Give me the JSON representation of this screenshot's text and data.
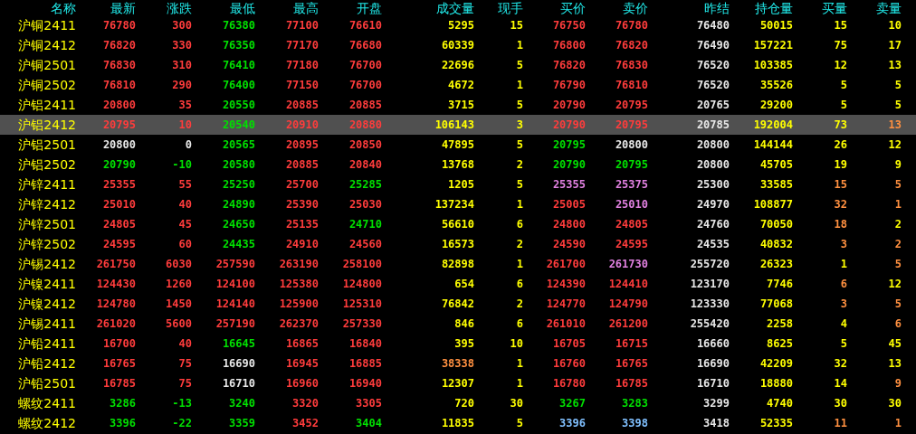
{
  "columns": [
    "名称",
    "最新",
    "涨跌",
    "最低",
    "最高",
    "开盘",
    "成交量",
    "现手",
    "买价",
    "卖价",
    "昨结",
    "持仓量",
    "买量",
    "卖量"
  ],
  "rows": [
    {
      "selected": false,
      "cells": [
        {
          "text": "沪铜2411",
          "color": "#ffff00"
        },
        {
          "text": "76780",
          "color": "#ff3c3c"
        },
        {
          "text": "300",
          "color": "#ff3c3c"
        },
        {
          "text": "76380",
          "color": "#00e000"
        },
        {
          "text": "77100",
          "color": "#ff3c3c"
        },
        {
          "text": "76610",
          "color": "#ff3c3c"
        },
        {
          "text": "5295",
          "color": "#ffff00"
        },
        {
          "text": "15",
          "color": "#ffff00"
        },
        {
          "text": "76750",
          "color": "#ff3c3c"
        },
        {
          "text": "76780",
          "color": "#ff3c3c"
        },
        {
          "text": "76480",
          "color": "#e8e8e8"
        },
        {
          "text": "50015",
          "color": "#ffff00"
        },
        {
          "text": "15",
          "color": "#ffff00"
        },
        {
          "text": "10",
          "color": "#ffff00"
        }
      ]
    },
    {
      "selected": false,
      "cells": [
        {
          "text": "沪铜2412",
          "color": "#ffff00"
        },
        {
          "text": "76820",
          "color": "#ff3c3c"
        },
        {
          "text": "330",
          "color": "#ff3c3c"
        },
        {
          "text": "76350",
          "color": "#00e000"
        },
        {
          "text": "77170",
          "color": "#ff3c3c"
        },
        {
          "text": "76680",
          "color": "#ff3c3c"
        },
        {
          "text": "60339",
          "color": "#ffff00"
        },
        {
          "text": "1",
          "color": "#ffff00"
        },
        {
          "text": "76800",
          "color": "#ff3c3c"
        },
        {
          "text": "76820",
          "color": "#ff3c3c"
        },
        {
          "text": "76490",
          "color": "#e8e8e8"
        },
        {
          "text": "157221",
          "color": "#ffff00"
        },
        {
          "text": "75",
          "color": "#ffff00"
        },
        {
          "text": "17",
          "color": "#ffff00"
        }
      ]
    },
    {
      "selected": false,
      "cells": [
        {
          "text": "沪铜2501",
          "color": "#ffff00"
        },
        {
          "text": "76830",
          "color": "#ff3c3c"
        },
        {
          "text": "310",
          "color": "#ff3c3c"
        },
        {
          "text": "76410",
          "color": "#00e000"
        },
        {
          "text": "77180",
          "color": "#ff3c3c"
        },
        {
          "text": "76700",
          "color": "#ff3c3c"
        },
        {
          "text": "22696",
          "color": "#ffff00"
        },
        {
          "text": "5",
          "color": "#ffff00"
        },
        {
          "text": "76820",
          "color": "#ff3c3c"
        },
        {
          "text": "76830",
          "color": "#ff3c3c"
        },
        {
          "text": "76520",
          "color": "#e8e8e8"
        },
        {
          "text": "103385",
          "color": "#ffff00"
        },
        {
          "text": "12",
          "color": "#ffff00"
        },
        {
          "text": "13",
          "color": "#ffff00"
        }
      ]
    },
    {
      "selected": false,
      "cells": [
        {
          "text": "沪铜2502",
          "color": "#ffff00"
        },
        {
          "text": "76810",
          "color": "#ff3c3c"
        },
        {
          "text": "290",
          "color": "#ff3c3c"
        },
        {
          "text": "76400",
          "color": "#00e000"
        },
        {
          "text": "77150",
          "color": "#ff3c3c"
        },
        {
          "text": "76700",
          "color": "#ff3c3c"
        },
        {
          "text": "4672",
          "color": "#ffff00"
        },
        {
          "text": "1",
          "color": "#ffff00"
        },
        {
          "text": "76790",
          "color": "#ff3c3c"
        },
        {
          "text": "76810",
          "color": "#ff3c3c"
        },
        {
          "text": "76520",
          "color": "#e8e8e8"
        },
        {
          "text": "35526",
          "color": "#ffff00"
        },
        {
          "text": "5",
          "color": "#ffff00"
        },
        {
          "text": "5",
          "color": "#ffff00"
        }
      ]
    },
    {
      "selected": false,
      "cells": [
        {
          "text": "沪铝2411",
          "color": "#ffff00"
        },
        {
          "text": "20800",
          "color": "#ff3c3c"
        },
        {
          "text": "35",
          "color": "#ff3c3c"
        },
        {
          "text": "20550",
          "color": "#00e000"
        },
        {
          "text": "20885",
          "color": "#ff3c3c"
        },
        {
          "text": "20885",
          "color": "#ff3c3c"
        },
        {
          "text": "3715",
          "color": "#ffff00"
        },
        {
          "text": "5",
          "color": "#ffff00"
        },
        {
          "text": "20790",
          "color": "#ff3c3c"
        },
        {
          "text": "20795",
          "color": "#ff3c3c"
        },
        {
          "text": "20765",
          "color": "#e8e8e8"
        },
        {
          "text": "29200",
          "color": "#ffff00"
        },
        {
          "text": "5",
          "color": "#ffff00"
        },
        {
          "text": "5",
          "color": "#ffff00"
        }
      ]
    },
    {
      "selected": true,
      "cells": [
        {
          "text": "沪铝2412",
          "color": "#ffff00"
        },
        {
          "text": "20795",
          "color": "#ff3c3c"
        },
        {
          "text": "10",
          "color": "#ff3c3c"
        },
        {
          "text": "20540",
          "color": "#00e000"
        },
        {
          "text": "20910",
          "color": "#ff3c3c"
        },
        {
          "text": "20880",
          "color": "#ff3c3c"
        },
        {
          "text": "106143",
          "color": "#ffff00"
        },
        {
          "text": "3",
          "color": "#ffff00"
        },
        {
          "text": "20790",
          "color": "#ff3c3c"
        },
        {
          "text": "20795",
          "color": "#ff3c3c"
        },
        {
          "text": "20785",
          "color": "#e8e8e8"
        },
        {
          "text": "192004",
          "color": "#ffff00"
        },
        {
          "text": "73",
          "color": "#ffff00"
        },
        {
          "text": "13",
          "color": "#ff9040"
        }
      ]
    },
    {
      "selected": false,
      "cells": [
        {
          "text": "沪铝2501",
          "color": "#ffff00"
        },
        {
          "text": "20800",
          "color": "#e8e8e8"
        },
        {
          "text": "0",
          "color": "#e8e8e8"
        },
        {
          "text": "20565",
          "color": "#00e000"
        },
        {
          "text": "20895",
          "color": "#ff3c3c"
        },
        {
          "text": "20850",
          "color": "#ff3c3c"
        },
        {
          "text": "47895",
          "color": "#ffff00"
        },
        {
          "text": "5",
          "color": "#ffff00"
        },
        {
          "text": "20795",
          "color": "#00e000"
        },
        {
          "text": "20800",
          "color": "#e8e8e8"
        },
        {
          "text": "20800",
          "color": "#e8e8e8"
        },
        {
          "text": "144144",
          "color": "#ffff00"
        },
        {
          "text": "26",
          "color": "#ffff00"
        },
        {
          "text": "12",
          "color": "#ffff00"
        }
      ]
    },
    {
      "selected": false,
      "cells": [
        {
          "text": "沪铝2502",
          "color": "#ffff00"
        },
        {
          "text": "20790",
          "color": "#00e000"
        },
        {
          "text": "-10",
          "color": "#00e000"
        },
        {
          "text": "20580",
          "color": "#00e000"
        },
        {
          "text": "20885",
          "color": "#ff3c3c"
        },
        {
          "text": "20840",
          "color": "#ff3c3c"
        },
        {
          "text": "13768",
          "color": "#ffff00"
        },
        {
          "text": "2",
          "color": "#ffff00"
        },
        {
          "text": "20790",
          "color": "#00e000"
        },
        {
          "text": "20795",
          "color": "#00e000"
        },
        {
          "text": "20800",
          "color": "#e8e8e8"
        },
        {
          "text": "45705",
          "color": "#ffff00"
        },
        {
          "text": "19",
          "color": "#ffff00"
        },
        {
          "text": "9",
          "color": "#ffff00"
        }
      ]
    },
    {
      "selected": false,
      "cells": [
        {
          "text": "沪锌2411",
          "color": "#ffff00"
        },
        {
          "text": "25355",
          "color": "#ff3c3c"
        },
        {
          "text": "55",
          "color": "#ff3c3c"
        },
        {
          "text": "25250",
          "color": "#00e000"
        },
        {
          "text": "25700",
          "color": "#ff3c3c"
        },
        {
          "text": "25285",
          "color": "#00e000"
        },
        {
          "text": "1205",
          "color": "#ffff00"
        },
        {
          "text": "5",
          "color": "#ffff00"
        },
        {
          "text": "25355",
          "color": "#e080e0"
        },
        {
          "text": "25375",
          "color": "#e080e0"
        },
        {
          "text": "25300",
          "color": "#e8e8e8"
        },
        {
          "text": "33585",
          "color": "#ffff00"
        },
        {
          "text": "15",
          "color": "#ff9040"
        },
        {
          "text": "5",
          "color": "#ff9040"
        }
      ]
    },
    {
      "selected": false,
      "cells": [
        {
          "text": "沪锌2412",
          "color": "#ffff00"
        },
        {
          "text": "25010",
          "color": "#ff3c3c"
        },
        {
          "text": "40",
          "color": "#ff3c3c"
        },
        {
          "text": "24890",
          "color": "#00e000"
        },
        {
          "text": "25390",
          "color": "#ff3c3c"
        },
        {
          "text": "25030",
          "color": "#ff3c3c"
        },
        {
          "text": "137234",
          "color": "#ffff00"
        },
        {
          "text": "1",
          "color": "#ffff00"
        },
        {
          "text": "25005",
          "color": "#ff3c3c"
        },
        {
          "text": "25010",
          "color": "#e080e0"
        },
        {
          "text": "24970",
          "color": "#e8e8e8"
        },
        {
          "text": "108877",
          "color": "#ffff00"
        },
        {
          "text": "32",
          "color": "#ff9040"
        },
        {
          "text": "1",
          "color": "#ff9040"
        }
      ]
    },
    {
      "selected": false,
      "cells": [
        {
          "text": "沪锌2501",
          "color": "#ffff00"
        },
        {
          "text": "24805",
          "color": "#ff3c3c"
        },
        {
          "text": "45",
          "color": "#ff3c3c"
        },
        {
          "text": "24650",
          "color": "#00e000"
        },
        {
          "text": "25135",
          "color": "#ff3c3c"
        },
        {
          "text": "24710",
          "color": "#00e000"
        },
        {
          "text": "56610",
          "color": "#ffff00"
        },
        {
          "text": "6",
          "color": "#ffff00"
        },
        {
          "text": "24800",
          "color": "#ff3c3c"
        },
        {
          "text": "24805",
          "color": "#ff3c3c"
        },
        {
          "text": "24760",
          "color": "#e8e8e8"
        },
        {
          "text": "70050",
          "color": "#ffff00"
        },
        {
          "text": "18",
          "color": "#ff9040"
        },
        {
          "text": "2",
          "color": "#ffff00"
        }
      ]
    },
    {
      "selected": false,
      "cells": [
        {
          "text": "沪锌2502",
          "color": "#ffff00"
        },
        {
          "text": "24595",
          "color": "#ff3c3c"
        },
        {
          "text": "60",
          "color": "#ff3c3c"
        },
        {
          "text": "24435",
          "color": "#00e000"
        },
        {
          "text": "24910",
          "color": "#ff3c3c"
        },
        {
          "text": "24560",
          "color": "#ff3c3c"
        },
        {
          "text": "16573",
          "color": "#ffff00"
        },
        {
          "text": "2",
          "color": "#ffff00"
        },
        {
          "text": "24590",
          "color": "#ff3c3c"
        },
        {
          "text": "24595",
          "color": "#ff3c3c"
        },
        {
          "text": "24535",
          "color": "#e8e8e8"
        },
        {
          "text": "40832",
          "color": "#ffff00"
        },
        {
          "text": "3",
          "color": "#ff9040"
        },
        {
          "text": "2",
          "color": "#ff9040"
        }
      ]
    },
    {
      "selected": false,
      "cells": [
        {
          "text": "沪锡2412",
          "color": "#ffff00"
        },
        {
          "text": "261750",
          "color": "#ff3c3c"
        },
        {
          "text": "6030",
          "color": "#ff3c3c"
        },
        {
          "text": "257590",
          "color": "#ff3c3c"
        },
        {
          "text": "263190",
          "color": "#ff3c3c"
        },
        {
          "text": "258100",
          "color": "#ff3c3c"
        },
        {
          "text": "82898",
          "color": "#ffff00"
        },
        {
          "text": "1",
          "color": "#ffff00"
        },
        {
          "text": "261700",
          "color": "#ff3c3c"
        },
        {
          "text": "261730",
          "color": "#e080e0"
        },
        {
          "text": "255720",
          "color": "#e8e8e8"
        },
        {
          "text": "26323",
          "color": "#ffff00"
        },
        {
          "text": "1",
          "color": "#ffff00"
        },
        {
          "text": "5",
          "color": "#ff9040"
        }
      ]
    },
    {
      "selected": false,
      "cells": [
        {
          "text": "沪镍2411",
          "color": "#ffff00"
        },
        {
          "text": "124430",
          "color": "#ff3c3c"
        },
        {
          "text": "1260",
          "color": "#ff3c3c"
        },
        {
          "text": "124100",
          "color": "#ff3c3c"
        },
        {
          "text": "125380",
          "color": "#ff3c3c"
        },
        {
          "text": "124800",
          "color": "#ff3c3c"
        },
        {
          "text": "654",
          "color": "#ffff00"
        },
        {
          "text": "6",
          "color": "#ffff00"
        },
        {
          "text": "124390",
          "color": "#ff3c3c"
        },
        {
          "text": "124410",
          "color": "#ff3c3c"
        },
        {
          "text": "123170",
          "color": "#e8e8e8"
        },
        {
          "text": "7746",
          "color": "#ffff00"
        },
        {
          "text": "6",
          "color": "#ff9040"
        },
        {
          "text": "12",
          "color": "#ffff00"
        }
      ]
    },
    {
      "selected": false,
      "cells": [
        {
          "text": "沪镍2412",
          "color": "#ffff00"
        },
        {
          "text": "124780",
          "color": "#ff3c3c"
        },
        {
          "text": "1450",
          "color": "#ff3c3c"
        },
        {
          "text": "124140",
          "color": "#ff3c3c"
        },
        {
          "text": "125900",
          "color": "#ff3c3c"
        },
        {
          "text": "125310",
          "color": "#ff3c3c"
        },
        {
          "text": "76842",
          "color": "#ffff00"
        },
        {
          "text": "2",
          "color": "#ffff00"
        },
        {
          "text": "124770",
          "color": "#ff3c3c"
        },
        {
          "text": "124790",
          "color": "#ff3c3c"
        },
        {
          "text": "123330",
          "color": "#e8e8e8"
        },
        {
          "text": "77068",
          "color": "#ffff00"
        },
        {
          "text": "3",
          "color": "#ff9040"
        },
        {
          "text": "5",
          "color": "#ff9040"
        }
      ]
    },
    {
      "selected": false,
      "cells": [
        {
          "text": "沪锡2411",
          "color": "#ffff00"
        },
        {
          "text": "261020",
          "color": "#ff3c3c"
        },
        {
          "text": "5600",
          "color": "#ff3c3c"
        },
        {
          "text": "257190",
          "color": "#ff3c3c"
        },
        {
          "text": "262370",
          "color": "#ff3c3c"
        },
        {
          "text": "257330",
          "color": "#ff3c3c"
        },
        {
          "text": "846",
          "color": "#ffff00"
        },
        {
          "text": "6",
          "color": "#ffff00"
        },
        {
          "text": "261010",
          "color": "#ff3c3c"
        },
        {
          "text": "261200",
          "color": "#ff3c3c"
        },
        {
          "text": "255420",
          "color": "#e8e8e8"
        },
        {
          "text": "2258",
          "color": "#ffff00"
        },
        {
          "text": "4",
          "color": "#ffff00"
        },
        {
          "text": "6",
          "color": "#ff9040"
        }
      ]
    },
    {
      "selected": false,
      "cells": [
        {
          "text": "沪铅2411",
          "color": "#ffff00"
        },
        {
          "text": "16700",
          "color": "#ff3c3c"
        },
        {
          "text": "40",
          "color": "#ff3c3c"
        },
        {
          "text": "16645",
          "color": "#00e000"
        },
        {
          "text": "16865",
          "color": "#ff3c3c"
        },
        {
          "text": "16840",
          "color": "#ff3c3c"
        },
        {
          "text": "395",
          "color": "#ffff00"
        },
        {
          "text": "10",
          "color": "#ffff00"
        },
        {
          "text": "16705",
          "color": "#ff3c3c"
        },
        {
          "text": "16715",
          "color": "#ff3c3c"
        },
        {
          "text": "16660",
          "color": "#e8e8e8"
        },
        {
          "text": "8625",
          "color": "#ffff00"
        },
        {
          "text": "5",
          "color": "#ffff00"
        },
        {
          "text": "45",
          "color": "#ffff00"
        }
      ]
    },
    {
      "selected": false,
      "cells": [
        {
          "text": "沪铅2412",
          "color": "#ffff00"
        },
        {
          "text": "16765",
          "color": "#ff3c3c"
        },
        {
          "text": "75",
          "color": "#ff3c3c"
        },
        {
          "text": "16690",
          "color": "#e8e8e8"
        },
        {
          "text": "16945",
          "color": "#ff3c3c"
        },
        {
          "text": "16885",
          "color": "#ff3c3c"
        },
        {
          "text": "38338",
          "color": "#ff9040"
        },
        {
          "text": "1",
          "color": "#ffff00"
        },
        {
          "text": "16760",
          "color": "#ff3c3c"
        },
        {
          "text": "16765",
          "color": "#ff3c3c"
        },
        {
          "text": "16690",
          "color": "#e8e8e8"
        },
        {
          "text": "42209",
          "color": "#ffff00"
        },
        {
          "text": "32",
          "color": "#ffff00"
        },
        {
          "text": "13",
          "color": "#ffff00"
        }
      ]
    },
    {
      "selected": false,
      "cells": [
        {
          "text": "沪铅2501",
          "color": "#ffff00"
        },
        {
          "text": "16785",
          "color": "#ff3c3c"
        },
        {
          "text": "75",
          "color": "#ff3c3c"
        },
        {
          "text": "16710",
          "color": "#e8e8e8"
        },
        {
          "text": "16960",
          "color": "#ff3c3c"
        },
        {
          "text": "16940",
          "color": "#ff3c3c"
        },
        {
          "text": "12307",
          "color": "#ffff00"
        },
        {
          "text": "1",
          "color": "#ffff00"
        },
        {
          "text": "16780",
          "color": "#ff3c3c"
        },
        {
          "text": "16785",
          "color": "#ff3c3c"
        },
        {
          "text": "16710",
          "color": "#e8e8e8"
        },
        {
          "text": "18880",
          "color": "#ffff00"
        },
        {
          "text": "14",
          "color": "#ffff00"
        },
        {
          "text": "9",
          "color": "#ff9040"
        }
      ]
    },
    {
      "selected": false,
      "cells": [
        {
          "text": "螺纹2411",
          "color": "#ffff00"
        },
        {
          "text": "3286",
          "color": "#00e000"
        },
        {
          "text": "-13",
          "color": "#00e000"
        },
        {
          "text": "3240",
          "color": "#00e000"
        },
        {
          "text": "3320",
          "color": "#ff3c3c"
        },
        {
          "text": "3305",
          "color": "#ff3c3c"
        },
        {
          "text": "720",
          "color": "#ffff00"
        },
        {
          "text": "30",
          "color": "#ffff00"
        },
        {
          "text": "3267",
          "color": "#00e000"
        },
        {
          "text": "3283",
          "color": "#00e000"
        },
        {
          "text": "3299",
          "color": "#e8e8e8"
        },
        {
          "text": "4740",
          "color": "#ffff00"
        },
        {
          "text": "30",
          "color": "#ffff00"
        },
        {
          "text": "30",
          "color": "#ffff00"
        }
      ]
    },
    {
      "selected": false,
      "cells": [
        {
          "text": "螺纹2412",
          "color": "#ffff00"
        },
        {
          "text": "3396",
          "color": "#00e000"
        },
        {
          "text": "-22",
          "color": "#00e000"
        },
        {
          "text": "3359",
          "color": "#00e000"
        },
        {
          "text": "3452",
          "color": "#ff3c3c"
        },
        {
          "text": "3404",
          "color": "#00e000"
        },
        {
          "text": "11835",
          "color": "#ffff00"
        },
        {
          "text": "5",
          "color": "#ffff00"
        },
        {
          "text": "3396",
          "color": "#80c0ff"
        },
        {
          "text": "3398",
          "color": "#80c0ff"
        },
        {
          "text": "3418",
          "color": "#e8e8e8"
        },
        {
          "text": "52335",
          "color": "#ffff00"
        },
        {
          "text": "11",
          "color": "#ff9040"
        },
        {
          "text": "1",
          "color": "#ff9040"
        }
      ]
    }
  ]
}
